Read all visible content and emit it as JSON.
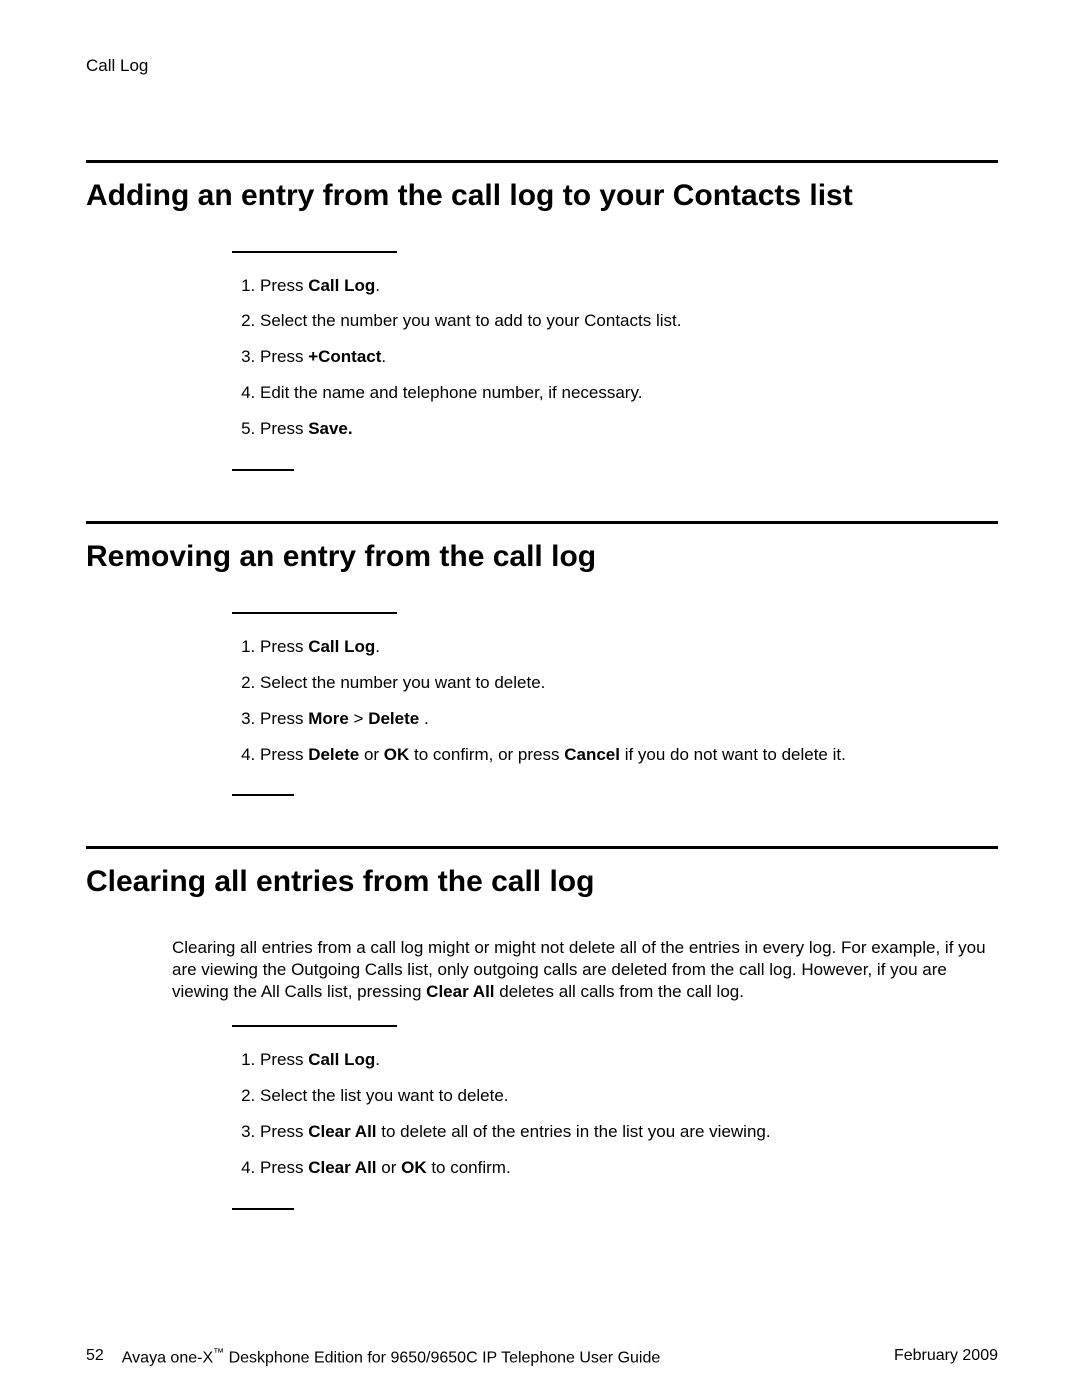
{
  "running_head": "Call Log",
  "sections": [
    {
      "heading": "Adding an entry from the call log to your Contacts list",
      "intro_html": "",
      "steps_html": [
        "Press <b>Call Log</b>.",
        "Select the number you want to add to your Contacts list.",
        "Press <b>+Contact</b>.",
        "Edit the name and telephone number, if necessary.",
        "Press <b>Save.</b>"
      ]
    },
    {
      "heading": "Removing an entry from the call log",
      "intro_html": "",
      "steps_html": [
        "Press <b>Call Log</b>.",
        "Select the number you want to delete.",
        "Press <b>More</b> &gt; <b>Delete</b> .",
        "Press <b>Delete</b> or <b>OK</b> to confirm, or press <b>Cancel</b> if you do not want to delete it."
      ]
    },
    {
      "heading": "Clearing all entries from the call log",
      "intro_html": "Clearing all entries from a call log might or might not delete all of the entries in every log. For example, if you are viewing the Outgoing Calls list, only outgoing calls are deleted from the call log. However, if you are viewing the All Calls list, pressing <b>Clear All</b> deletes all calls from the call log.",
      "steps_html": [
        "Press <b>Call Log</b>.",
        "Select the list you want to delete.",
        "Press <b>Clear All</b> to delete all of the entries in the list you are viewing.",
        "Press <b>Clear All</b> or <b>OK</b> to confirm."
      ]
    }
  ],
  "footer": {
    "page_number": "52",
    "doc_title_html": "Avaya one-X<span class=\"tm\">™</span> Deskphone Edition for 9650/9650C IP Telephone User Guide",
    "date": "February 2009"
  }
}
